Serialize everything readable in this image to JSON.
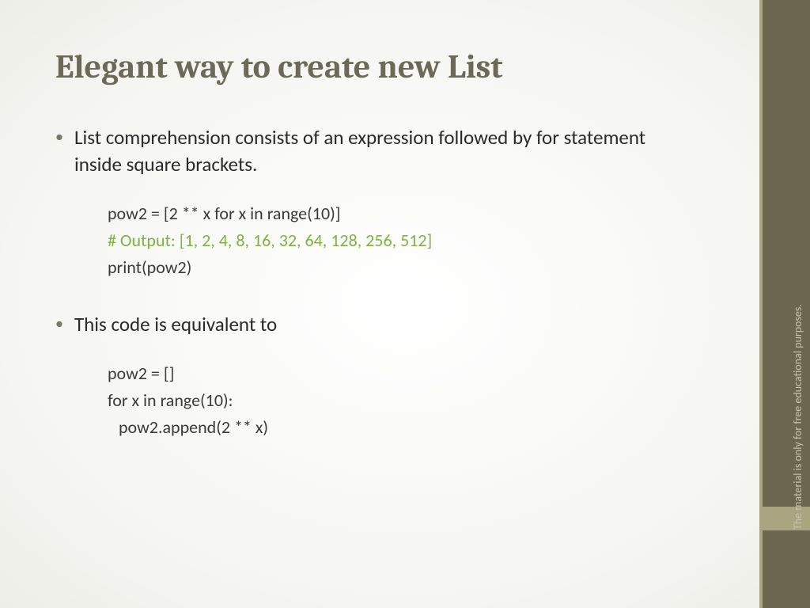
{
  "title": "Elegant way to create new List",
  "bullet1": "List comprehension consists of an expression followed by for statement inside square brackets.",
  "code1": {
    "line1": "pow2 = [2 ** x for x in range(10)]",
    "comment": "# Output: [1, 2, 4, 8, 16, 32, 64, 128, 256, 512]",
    "line2": "print(pow2)"
  },
  "bullet2": "This code is equivalent to",
  "code2": {
    "line1": "pow2 = []",
    "line2": "for x in range(10):",
    "line3": "pow2.append(2 ** x)"
  },
  "sidebar_text": "The material is only for free educational purposes."
}
